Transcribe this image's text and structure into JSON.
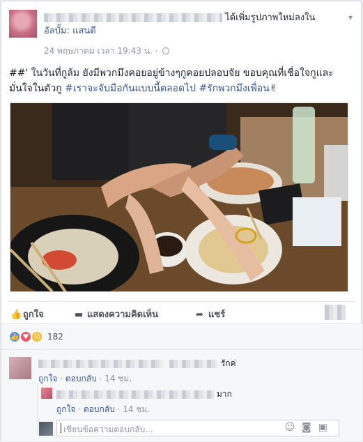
{
  "post": {
    "action_text": "ได้เพิ่มรูปภาพใหม่ลงใน",
    "album_text": "อัลบั้ม: แสนดี",
    "timestamp": "24 พฤษภาคม เวลา 19:43 น.",
    "separator": "·",
    "text_plain": "##' ในวันที่กูล้ม ยังมีพวกมึงคอยอยู่ข้างๆกูคอยปลอบจัย ขอบคุณที่เชื่อใจกูและมั่นใจในตัวกู ",
    "hashtag_1": "#เราจะจับมือกันแบบนี้ตลอดไป",
    "hashtag_2": "#รักพวกมึงเพื่อน",
    "emoji": "✌"
  },
  "actions": {
    "like_label": "ถูกใจ",
    "comment_label": "แสดงความคิดเห็น",
    "share_label": "แชร์"
  },
  "reactions": {
    "count": "182"
  },
  "comments": [
    {
      "text_suffix": "รักค่",
      "like_link": "ถูกใจ",
      "reply_link": "ตอบกลับ",
      "time": "14 ชม."
    },
    {
      "text_suffix": "มาก",
      "like_link": "ถูกใจ",
      "reply_link": "ตอบกลับ",
      "time": "14 ชม."
    }
  ],
  "reply_input": {
    "placeholder": "เขียนข้อความตอบกลับ..."
  },
  "icons": {
    "chevron": "chevron-down-icon",
    "globe": "globe-icon",
    "like": "thumbs-up-icon",
    "comment": "comment-icon",
    "share": "share-icon",
    "emoji": "emoji-icon",
    "camera": "camera-icon",
    "sticker": "sticker-icon"
  },
  "colors": {
    "link": "#365899",
    "like_blue": "#5890ff",
    "love_red": "#f25268",
    "wow_yellow": "#f7b928"
  }
}
